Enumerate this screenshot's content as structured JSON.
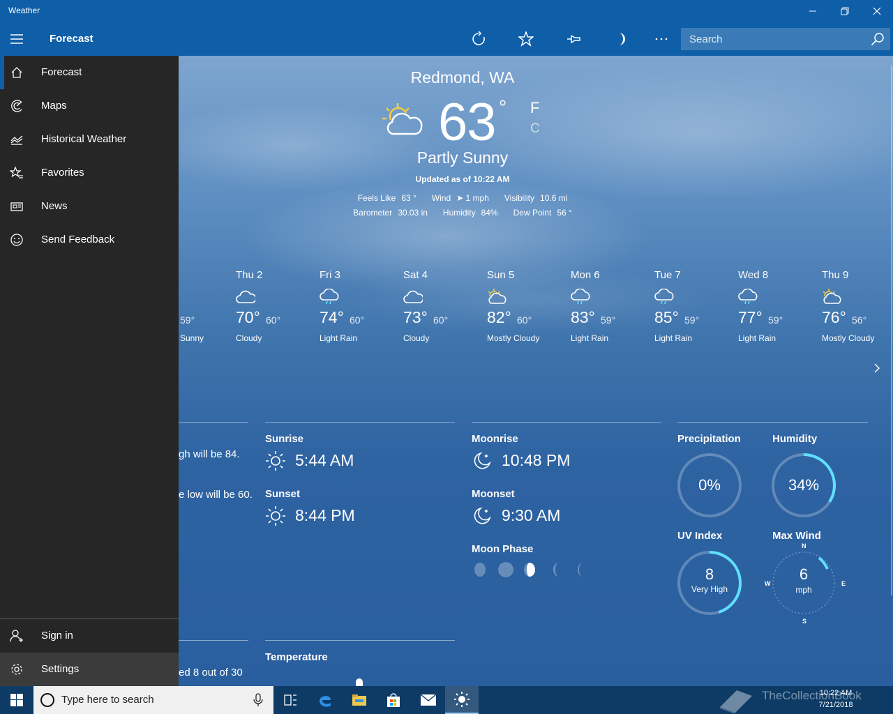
{
  "window": {
    "title": "Weather",
    "minimize_icon": "minimize-icon",
    "maximize_icon": "restore-icon",
    "close_icon": "close-icon"
  },
  "appbar": {
    "heading": "Forecast",
    "tools": [
      "refresh-icon",
      "favorite-star-icon",
      "pin-icon",
      "moon-theme-icon",
      "more-icon"
    ],
    "search_placeholder": "Search"
  },
  "nav": {
    "items": [
      {
        "label": "Forecast",
        "icon": "home-icon"
      },
      {
        "label": "Maps",
        "icon": "radar-icon"
      },
      {
        "label": "Historical Weather",
        "icon": "chart-icon"
      },
      {
        "label": "Favorites",
        "icon": "star-list-icon"
      },
      {
        "label": "News",
        "icon": "news-icon"
      },
      {
        "label": "Send Feedback",
        "icon": "smiley-icon"
      }
    ],
    "footer": [
      {
        "label": "Sign in",
        "icon": "person-icon"
      },
      {
        "label": "Settings",
        "icon": "gear-icon"
      }
    ]
  },
  "current": {
    "location": "Redmond, WA",
    "temp": "63",
    "degree": "°",
    "unit_f": "F",
    "unit_c": "C",
    "condition": "Partly Sunny",
    "updated": "Updated as of 10:22 AM",
    "details_row1": [
      {
        "label": "Feels Like",
        "value": "63 °"
      },
      {
        "label": "Wind",
        "value": "➤ 1 mph"
      },
      {
        "label": "Visibility",
        "value": "10.6 mi"
      }
    ],
    "details_row2": [
      {
        "label": "Barometer",
        "value": "30.03 in"
      },
      {
        "label": "Humidity",
        "value": "84%"
      },
      {
        "label": "Dew Point",
        "value": "56 °"
      }
    ]
  },
  "daily": {
    "partial": {
      "lo": "59°",
      "cond": "Sunny"
    },
    "days": [
      {
        "name": "Thu 2",
        "hi": "70°",
        "lo": "60°",
        "cond": "Cloudy",
        "icon": "cloud"
      },
      {
        "name": "Fri 3",
        "hi": "74°",
        "lo": "60°",
        "cond": "Light Rain",
        "icon": "rain"
      },
      {
        "name": "Sat 4",
        "hi": "73°",
        "lo": "60°",
        "cond": "Cloudy",
        "icon": "cloud"
      },
      {
        "name": "Sun 5",
        "hi": "82°",
        "lo": "60°",
        "cond": "Mostly Cloudy",
        "icon": "suncloud"
      },
      {
        "name": "Mon 6",
        "hi": "83°",
        "lo": "59°",
        "cond": "Light Rain",
        "icon": "rain"
      },
      {
        "name": "Tue 7",
        "hi": "85°",
        "lo": "59°",
        "cond": "Light Rain",
        "icon": "rain"
      },
      {
        "name": "Wed 8",
        "hi": "77°",
        "lo": "59°",
        "cond": "Light Rain",
        "icon": "rain"
      },
      {
        "name": "Thu 9",
        "hi": "76°",
        "lo": "56°",
        "cond": "Mostly Cloudy",
        "icon": "suncloud"
      }
    ],
    "next_icon": "chevron-right-icon"
  },
  "summary": {
    "line1": "gh will be 84.",
    "line2": "e low will be 60.",
    "line3": "ed 8 out of 30"
  },
  "sun": {
    "sunrise_label": "Sunrise",
    "sunrise": "5:44 AM",
    "sunset_label": "Sunset",
    "sunset": "8:44 PM"
  },
  "moon": {
    "moonrise_label": "Moonrise",
    "moonrise": "10:48 PM",
    "moonset_label": "Moonset",
    "moonset": "9:30 AM",
    "phase_label": "Moon Phase"
  },
  "metrics": {
    "precip_label": "Precipitation",
    "precip": "0%",
    "precip_fraction": 0,
    "humidity_label": "Humidity",
    "humidity": "34%",
    "humidity_fraction": 0.34,
    "uv_label": "UV Index",
    "uv": "8",
    "uv_desc": "Very High",
    "uv_fraction": 0.45,
    "wind_label": "Max Wind",
    "wind": "6",
    "wind_unit": "mph",
    "compass": {
      "n": "N",
      "e": "E",
      "s": "S",
      "w": "W"
    }
  },
  "temperature_label": "Temperature",
  "taskbar": {
    "search_placeholder": "Type here to search",
    "clock_time": "10:22 AM",
    "clock_date": "7/21/2018",
    "watermark": "TheCollectionBook",
    "apps": [
      "task-view-icon",
      "edge-icon",
      "file-explorer-icon",
      "store-icon",
      "mail-icon",
      "weather-app-icon"
    ]
  }
}
